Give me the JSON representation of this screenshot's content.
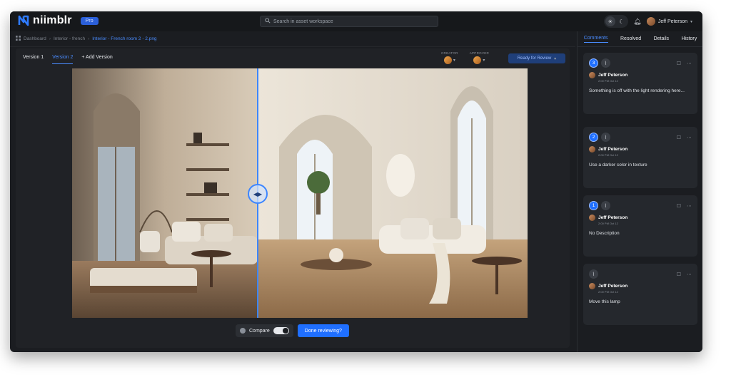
{
  "app": {
    "brand": "niimblr",
    "plan_badge": "Pro",
    "search_placeholder": "Search in asset workspace",
    "user_name": "Jeff Peterson"
  },
  "breadcrumb": [
    "Dashboard",
    "Interior - french",
    "Interior - French room 2 - 2.png"
  ],
  "versions": {
    "tabs": [
      "Version 1",
      "Version 2"
    ],
    "active_index": 1,
    "add_label": "+ Add Version"
  },
  "roles": {
    "creator_label": "CREATOR",
    "approver_label": "APPROVER"
  },
  "status_button": "Ready for Review",
  "compare": {
    "label": "Compare",
    "enabled": true,
    "done_label": "Done reviewing?"
  },
  "side_tabs": [
    "Comments",
    "Resolved",
    "Details",
    "History"
  ],
  "comments": [
    {
      "number": "3",
      "author": "Jeff Peterson",
      "time": "2:00 PM Oct 12",
      "text": "Something is off with the light rendering here..."
    },
    {
      "number": "2",
      "author": "Jeff Peterson",
      "time": "2:00 PM Oct 12",
      "text": "Use a darker color in texture"
    },
    {
      "number": "1",
      "author": "Jeff Peterson",
      "time": "2:00 PM Oct 12",
      "text": "No Description"
    },
    {
      "number": "",
      "author": "Jeff Peterson",
      "time": "2:00 PM Oct 12",
      "text": "Move this lamp"
    }
  ],
  "colors": {
    "accent": "#1f6fff",
    "background": "#1b1d21",
    "panel": "#25282d"
  }
}
